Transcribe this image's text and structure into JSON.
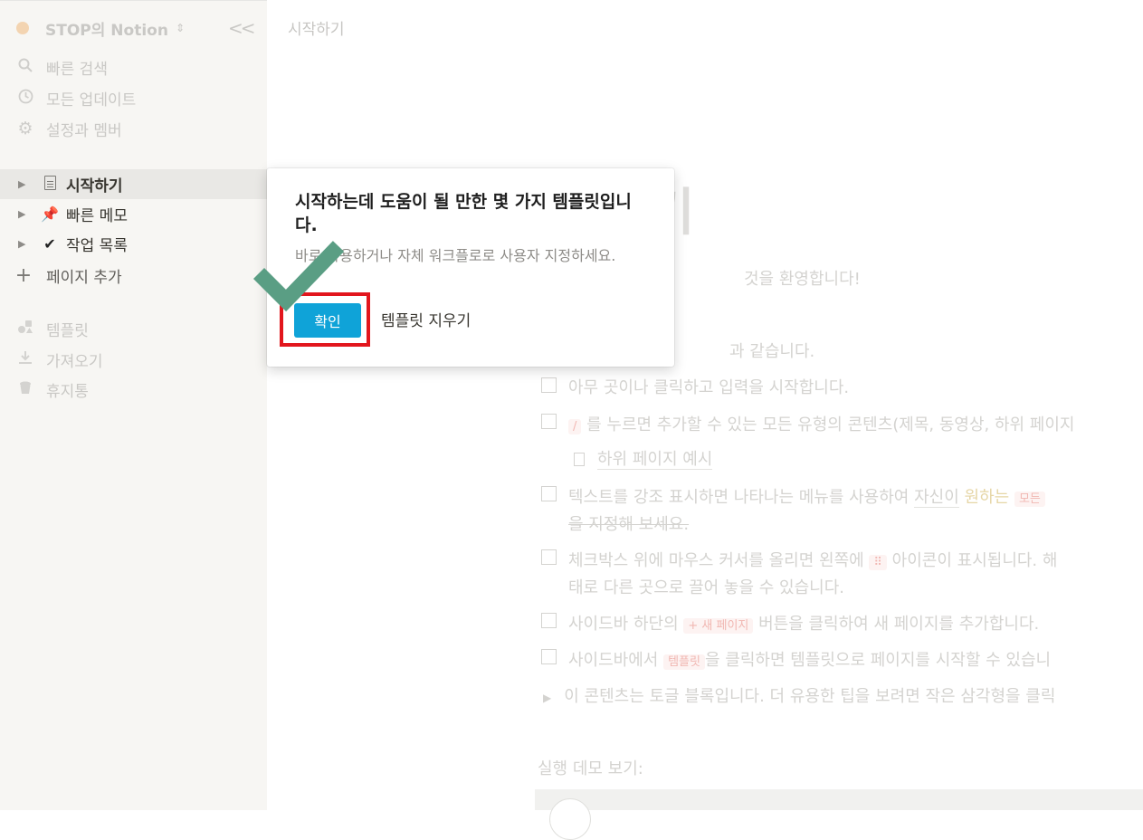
{
  "sidebar": {
    "workspace_name": "STOP의 Notion",
    "workspace_chevron": "⌃⌄",
    "collapse": "<<",
    "nav": [
      {
        "label": "빠른 검색",
        "icon": "search-icon"
      },
      {
        "label": "모든 업데이트",
        "icon": "clock-icon"
      },
      {
        "label": "설정과 멤버",
        "icon": "gear-icon"
      }
    ],
    "pages": [
      {
        "label": "시작하기",
        "icon": "document-icon",
        "active": true
      },
      {
        "label": "빠른 메모",
        "icon": "pushpin-icon",
        "glyph": "📌"
      },
      {
        "label": "작업 목록",
        "icon": "checkmark-icon",
        "glyph": "✔"
      }
    ],
    "add_page": "페이지 추가",
    "bottom": [
      {
        "label": "템플릿",
        "icon": "template-icon"
      },
      {
        "label": "가져오기",
        "icon": "download-icon"
      },
      {
        "label": "휴지통",
        "icon": "trash-icon"
      }
    ]
  },
  "main": {
    "breadcrumb": "시작하기",
    "title_fragment": "기",
    "welcome_fragment": "것을 환영합니다!",
    "intro_fragment": "과 같습니다.",
    "items": [
      {
        "text": "아무 곳이나 클릭하고 입력을 시작합니다."
      },
      {
        "chip": "/",
        "text": "를 누르면 추가할 수 있는 모든 유형의 콘텐츠(제목, 동영상, 하위 페이지"
      },
      {
        "text_a": "텍스트를 강조 표시하면 나타나는 메뉴를 사용하여 ",
        "underline": "자신이",
        "yellow": "원하는",
        "chip": "모든",
        "line2": "을 지정해 보세요."
      },
      {
        "text_a": "체크박스 위에 마우스 커서를 올리면 왼쪽에 ",
        "chip": "⠿",
        "text_b": " 아이콘이 표시됩니다. 해",
        "line2": "태로 다른 곳으로 끌어 놓을 수 있습니다."
      },
      {
        "text_a": "사이드바 하단의 ",
        "chip": "+ 새 페이지",
        "text_b": " 버튼을 클릭하여 새 페이지를 추가합니다."
      },
      {
        "text_a": "사이드바에서 ",
        "chip": "템플릿",
        "text_b": "을 클릭하면 템플릿으로 페이지를 시작할 수 있습니"
      }
    ],
    "subpage": "하위 페이지 예시",
    "toggle": "이 콘텐츠는 토글 블록입니다. 더 유용한 팁을 보려면 작은 삼각형을 클릭",
    "demo_label": "실행 데모 보기:"
  },
  "popup": {
    "title": "시작하는데 도움이 될 만한 몇 가지 템플릿입니다.",
    "description": "바로 사용하거나 자체 워크플로로 사용자 지정하세요.",
    "confirm_button": "확인",
    "clear_button": "템플릿 지우기"
  },
  "annotation": {
    "highlight_color": "#e2161d",
    "check_color": "#5a9e84"
  }
}
